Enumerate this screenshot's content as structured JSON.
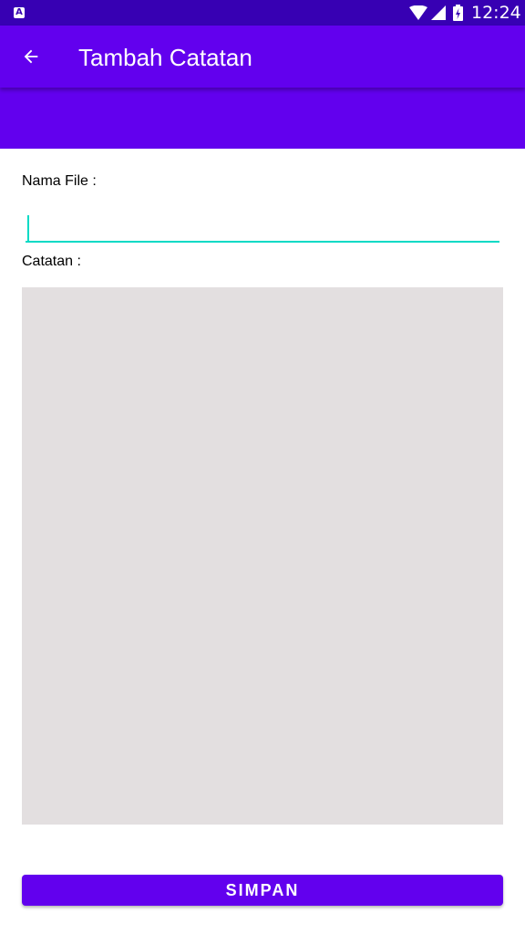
{
  "status_bar": {
    "time": "12:24",
    "app_icon_letter": "A",
    "icons": [
      "wifi-icon",
      "signal-icon",
      "battery-charging-icon"
    ]
  },
  "toolbar": {
    "title": "Tambah Catatan",
    "back_icon": "arrow-left-icon"
  },
  "form": {
    "filename_label": "Nama File :",
    "filename_value": "",
    "note_label": "Catatan :",
    "note_value": "",
    "save_label": "SIMPAN"
  },
  "colors": {
    "status_bar": "#3700b3",
    "primary": "#6200ee",
    "accent": "#03dac5",
    "note_background": "#e3dfe0"
  }
}
